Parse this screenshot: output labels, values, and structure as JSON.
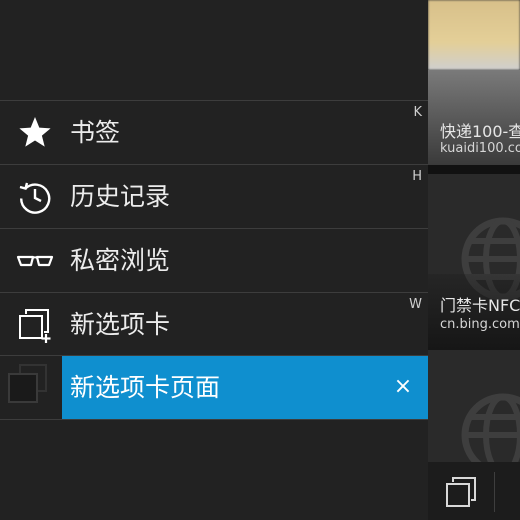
{
  "menu": {
    "items": [
      {
        "label": "书签",
        "icon": "star-icon",
        "shortcut": "K"
      },
      {
        "label": "历史记录",
        "icon": "history-icon",
        "shortcut": "H"
      },
      {
        "label": "私密浏览",
        "icon": "glasses-icon",
        "shortcut": ""
      },
      {
        "label": "新选项卡",
        "icon": "new-tab-icon",
        "shortcut": "W"
      }
    ]
  },
  "new_tab_page": {
    "label": "新选项卡页面",
    "close_icon": "close-icon",
    "close_glyph": "×"
  },
  "tabs_panel": {
    "cards": [
      {
        "title": "快递100-查",
        "url": "kuaidi100.com"
      },
      {
        "title": "门禁卡NFC",
        "url": "cn.bing.com"
      },
      {
        "title": "",
        "url": ""
      }
    ],
    "tabs_button_icon": "tabs-icon"
  },
  "colors": {
    "menu_bg": "#222222",
    "accent": "#0f8fcf",
    "text": "#ececec"
  }
}
